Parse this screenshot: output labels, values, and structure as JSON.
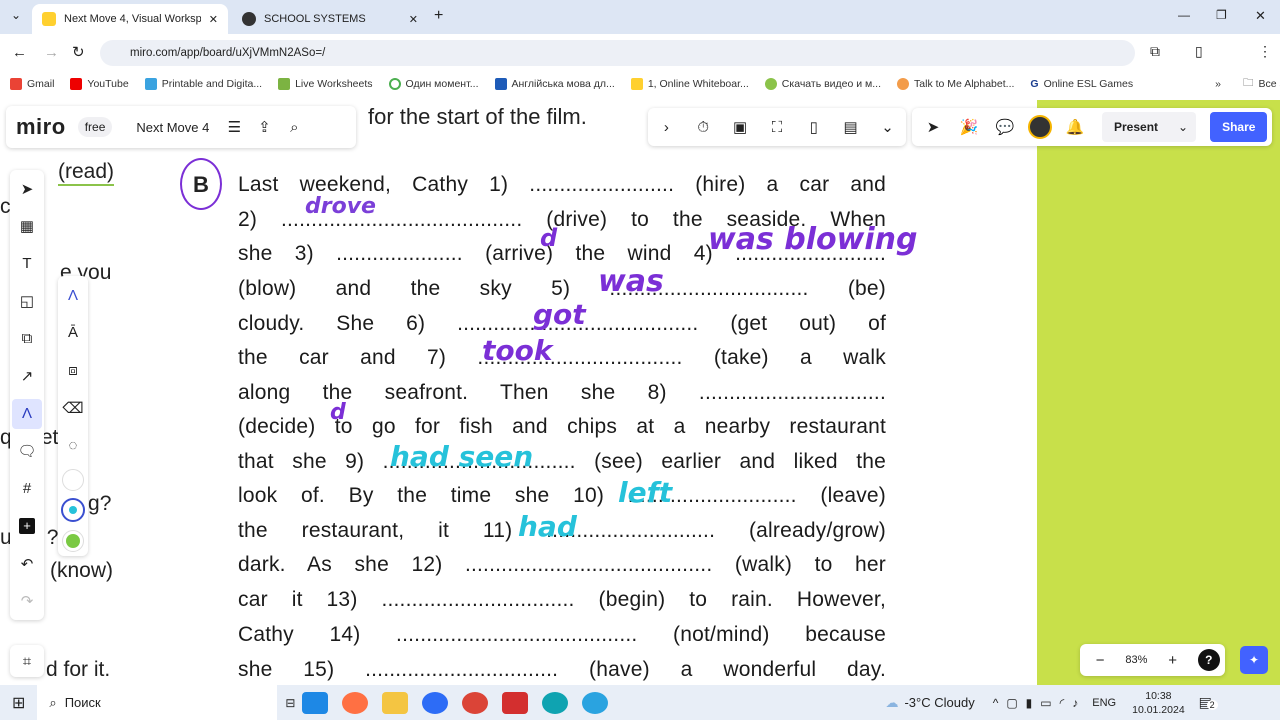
{
  "browser": {
    "tabs": [
      {
        "title": "Next Move 4, Visual Workspace",
        "active": true
      },
      {
        "title": "SCHOOL SYSTEMS",
        "active": false
      }
    ],
    "url": "miro.com/app/board/uXjVMmN2ASo=/",
    "bookmarks": [
      "Gmail",
      "YouTube",
      "Printable and Digita...",
      "Live Worksheets",
      "Один момент...",
      "Англійська мова дл...",
      "1, Online Whiteboar...",
      "Скачать видео и м...",
      "Talk to Me Alphabet...",
      "Online ESL Games"
    ],
    "all_bookmarks": "Все закладки",
    "more": "»"
  },
  "miro": {
    "logo": "miro",
    "plan": "free",
    "board_name": "Next Move 4",
    "present_label": "Present",
    "share_label": "Share",
    "zoom": "83%",
    "help": "?",
    "accent": "#4262ff",
    "board_bg": "#c8e04a"
  },
  "exercise": {
    "top_fragment": "for the start of the film.",
    "label": "B",
    "lines": [
      "Last weekend, Cathy 1) ........................ (hire) a car and",
      "2) ........................................ (drive) to the seaside. When",
      "she 3) ..................... (arrive) the wind 4) .........................",
      "(blow) and the sky 5) ................................. (be)",
      "cloudy. She 6) ........................................ (get out) of",
      "the car and 7) .................................. (take) a walk",
      "along the seafront. Then she 8) ...............................",
      "(decide) to go for fish and chips at a nearby restaurant",
      "that she 9) ................................ (see) earlier and liked the",
      "look of. By the time she 10) ............................ (leave)",
      "the restaurant, it 11) ............................ (already/grow)",
      "dark. As she 12) ......................................... (walk) to her",
      "car it 13) ................................ (begin) to rain. However,",
      "Cathy 14) ........................................ (not/mind) because",
      "she 15) ................................ (have) a wonderful day."
    ],
    "handwriting": [
      {
        "text": "drove",
        "color": "#7b3fd8"
      },
      {
        "text": "d",
        "color": "#7b2fd6"
      },
      {
        "text": "was blowing",
        "color": "#7b2fd6"
      },
      {
        "text": "was",
        "color": "#7b2fd6"
      },
      {
        "text": "got",
        "color": "#7b2fd6"
      },
      {
        "text": "took",
        "color": "#7b2fd6"
      },
      {
        "text": "d",
        "color": "#7b2fd6"
      },
      {
        "text": "had seen",
        "color": "#26c2da"
      },
      {
        "text": "left",
        "color": "#26c2da"
      },
      {
        "text": "had",
        "color": "#26c2da"
      }
    ],
    "left_fragments": [
      "(read)",
      "cl   s.",
      "e you",
      "q  r   ket",
      "y  ng?",
      "u uo  ?",
      "(know)",
      "d for it."
    ]
  },
  "taskbar": {
    "search": "Поиск",
    "weather": "-3°C  Cloudy",
    "lang": "ENG",
    "time": "10:38",
    "date": "10.01.2024",
    "notifications": "2"
  }
}
